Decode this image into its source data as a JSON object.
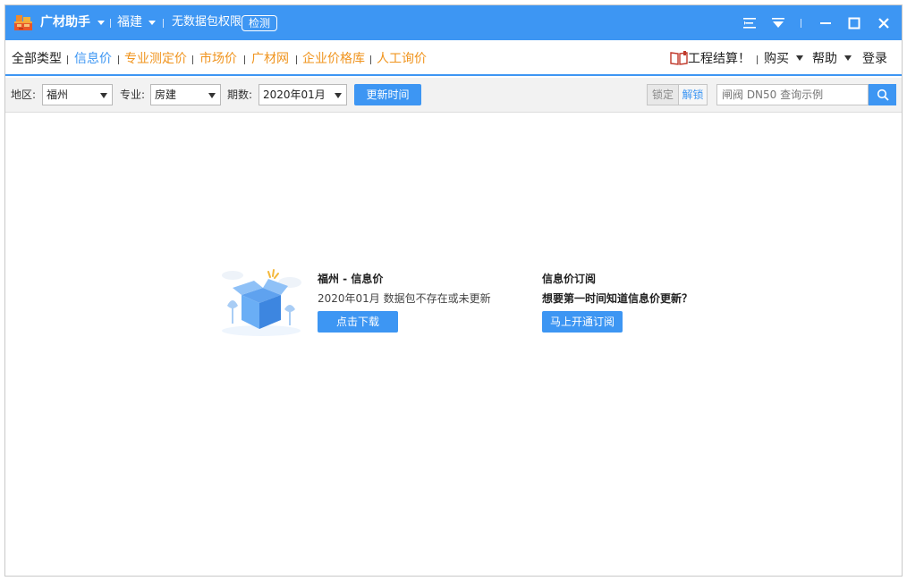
{
  "titlebar": {
    "app_name": "广材助手",
    "region": "福建",
    "permission_text": "无数据包权限",
    "check_button": "检测"
  },
  "nav": {
    "tabs": [
      {
        "label": "全部类型"
      },
      {
        "label": "信息价"
      },
      {
        "label": "专业测定价"
      },
      {
        "label": "市场价"
      },
      {
        "label": "广材网"
      },
      {
        "label": "企业价格库"
      },
      {
        "label": "人工询价"
      }
    ],
    "settlement": "工程结算！",
    "buy": "购买",
    "help": "帮助",
    "login": "登录"
  },
  "filters": {
    "region_label": "地区:",
    "region_value": "福州",
    "specialty_label": "专业:",
    "specialty_value": "房建",
    "period_label": "期数:",
    "period_value": "2020年01月",
    "update_button": "更新时间",
    "lock": "锁定",
    "unlock": "解锁",
    "search_placeholder": "闸阀 DN50 查询示例"
  },
  "empty_state": {
    "download_title": "福州 - 信息价",
    "download_desc": "2020年01月 数据包不存在或未更新",
    "download_button": "点击下载",
    "subscribe_title": "信息价订阅",
    "subscribe_desc": "想要第一时间知道信息价更新？",
    "subscribe_button": "马上开通订阅"
  },
  "colors": {
    "primary": "#3d96f3",
    "accent_orange": "#f0941e"
  }
}
